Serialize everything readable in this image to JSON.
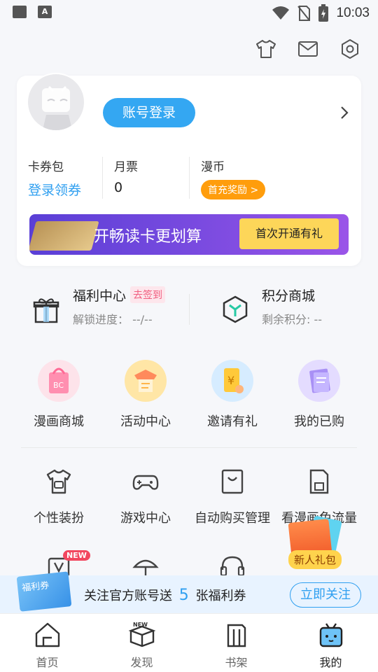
{
  "status_bar": {
    "time": "10:03"
  },
  "header_icons": [
    "tshirt-icon",
    "mail-icon",
    "settings-icon"
  ],
  "profile": {
    "login_label": "账号登录",
    "stats": [
      {
        "label": "卡券包",
        "value": "登录领券"
      },
      {
        "label": "月票",
        "value": "0"
      },
      {
        "label": "漫币",
        "value": "首充奖励 >"
      }
    ],
    "banner": {
      "text": "开畅读卡更划算",
      "button": "首次开通有礼"
    }
  },
  "welfare": {
    "title": "福利中心",
    "tag": "去签到",
    "progress_label": "解锁进度：",
    "progress_value": "--/--"
  },
  "points": {
    "title": "积分商城",
    "remaining": "剩余积分: --"
  },
  "main_grid": [
    {
      "label": "漫画商城",
      "icon": "shopping-bag-icon"
    },
    {
      "label": "活动中心",
      "icon": "activity-icon"
    },
    {
      "label": "邀请有礼",
      "icon": "invite-icon"
    },
    {
      "label": "我的已购",
      "icon": "purchased-icon"
    }
  ],
  "service_grid": [
    {
      "label": "个性装扮",
      "icon": "tshirt-icon"
    },
    {
      "label": "游戏中心",
      "icon": "gamepad-icon"
    },
    {
      "label": "自动购买管理",
      "icon": "auto-buy-icon"
    },
    {
      "label": "看漫画免流量",
      "icon": "sim-card-icon"
    }
  ],
  "third_row_badge": "NEW",
  "gift": {
    "label": "新人礼包"
  },
  "promo": {
    "ticket": "福利券",
    "text_before": "关注官方账号送",
    "count": "5",
    "text_after": "张福利券",
    "follow": "立即关注"
  },
  "tabs": [
    {
      "label": "首页",
      "icon": "home-icon"
    },
    {
      "label": "发现",
      "icon": "discover-icon"
    },
    {
      "label": "书架",
      "icon": "bookshelf-icon"
    },
    {
      "label": "我的",
      "icon": "profile-icon"
    }
  ],
  "colors": {
    "accent": "#34a7f2",
    "orange": "#ff9d0c",
    "banner_purple": "#6a45dc"
  }
}
